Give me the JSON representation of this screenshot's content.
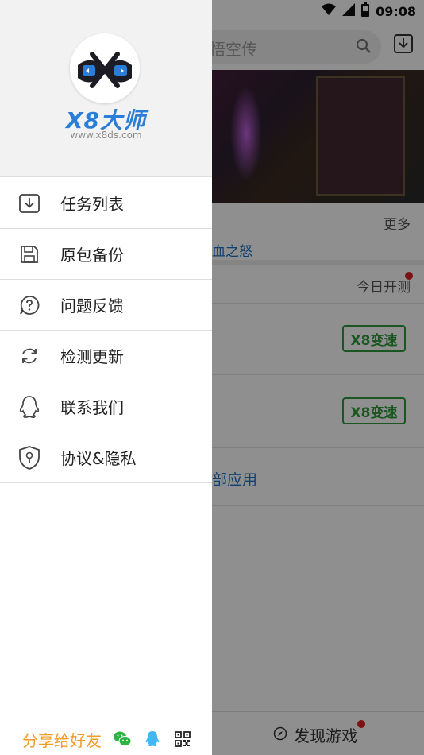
{
  "status_bar": {
    "time": "09:08"
  },
  "background": {
    "search_placeholder": "悟空传",
    "more_label": "更多",
    "partial_game_title": "血之怒",
    "today_test_label": "今日开测",
    "x8_badge_1": "X8变速",
    "x8_badge_2": "X8变速",
    "all_apps_label": "部应用",
    "discover_label": "发现游戏"
  },
  "drawer": {
    "brand_name": "X8大师",
    "brand_url": "www.x8ds.com",
    "menu": [
      {
        "label": "任务列表",
        "icon": "download-icon"
      },
      {
        "label": "原包备份",
        "icon": "save-icon"
      },
      {
        "label": "问题反馈",
        "icon": "feedback-icon"
      },
      {
        "label": "检测更新",
        "icon": "refresh-icon"
      },
      {
        "label": "联系我们",
        "icon": "qq-contact-icon"
      },
      {
        "label": "协议&隐私",
        "icon": "shield-lock-icon"
      }
    ],
    "share_label": "分享给好友"
  },
  "colors": {
    "brand_blue": "#2a7ed8",
    "share_orange": "#f29b26",
    "badge_green": "#2e9a3a",
    "link_blue": "#1a73c8",
    "alert_red": "#e02020"
  }
}
